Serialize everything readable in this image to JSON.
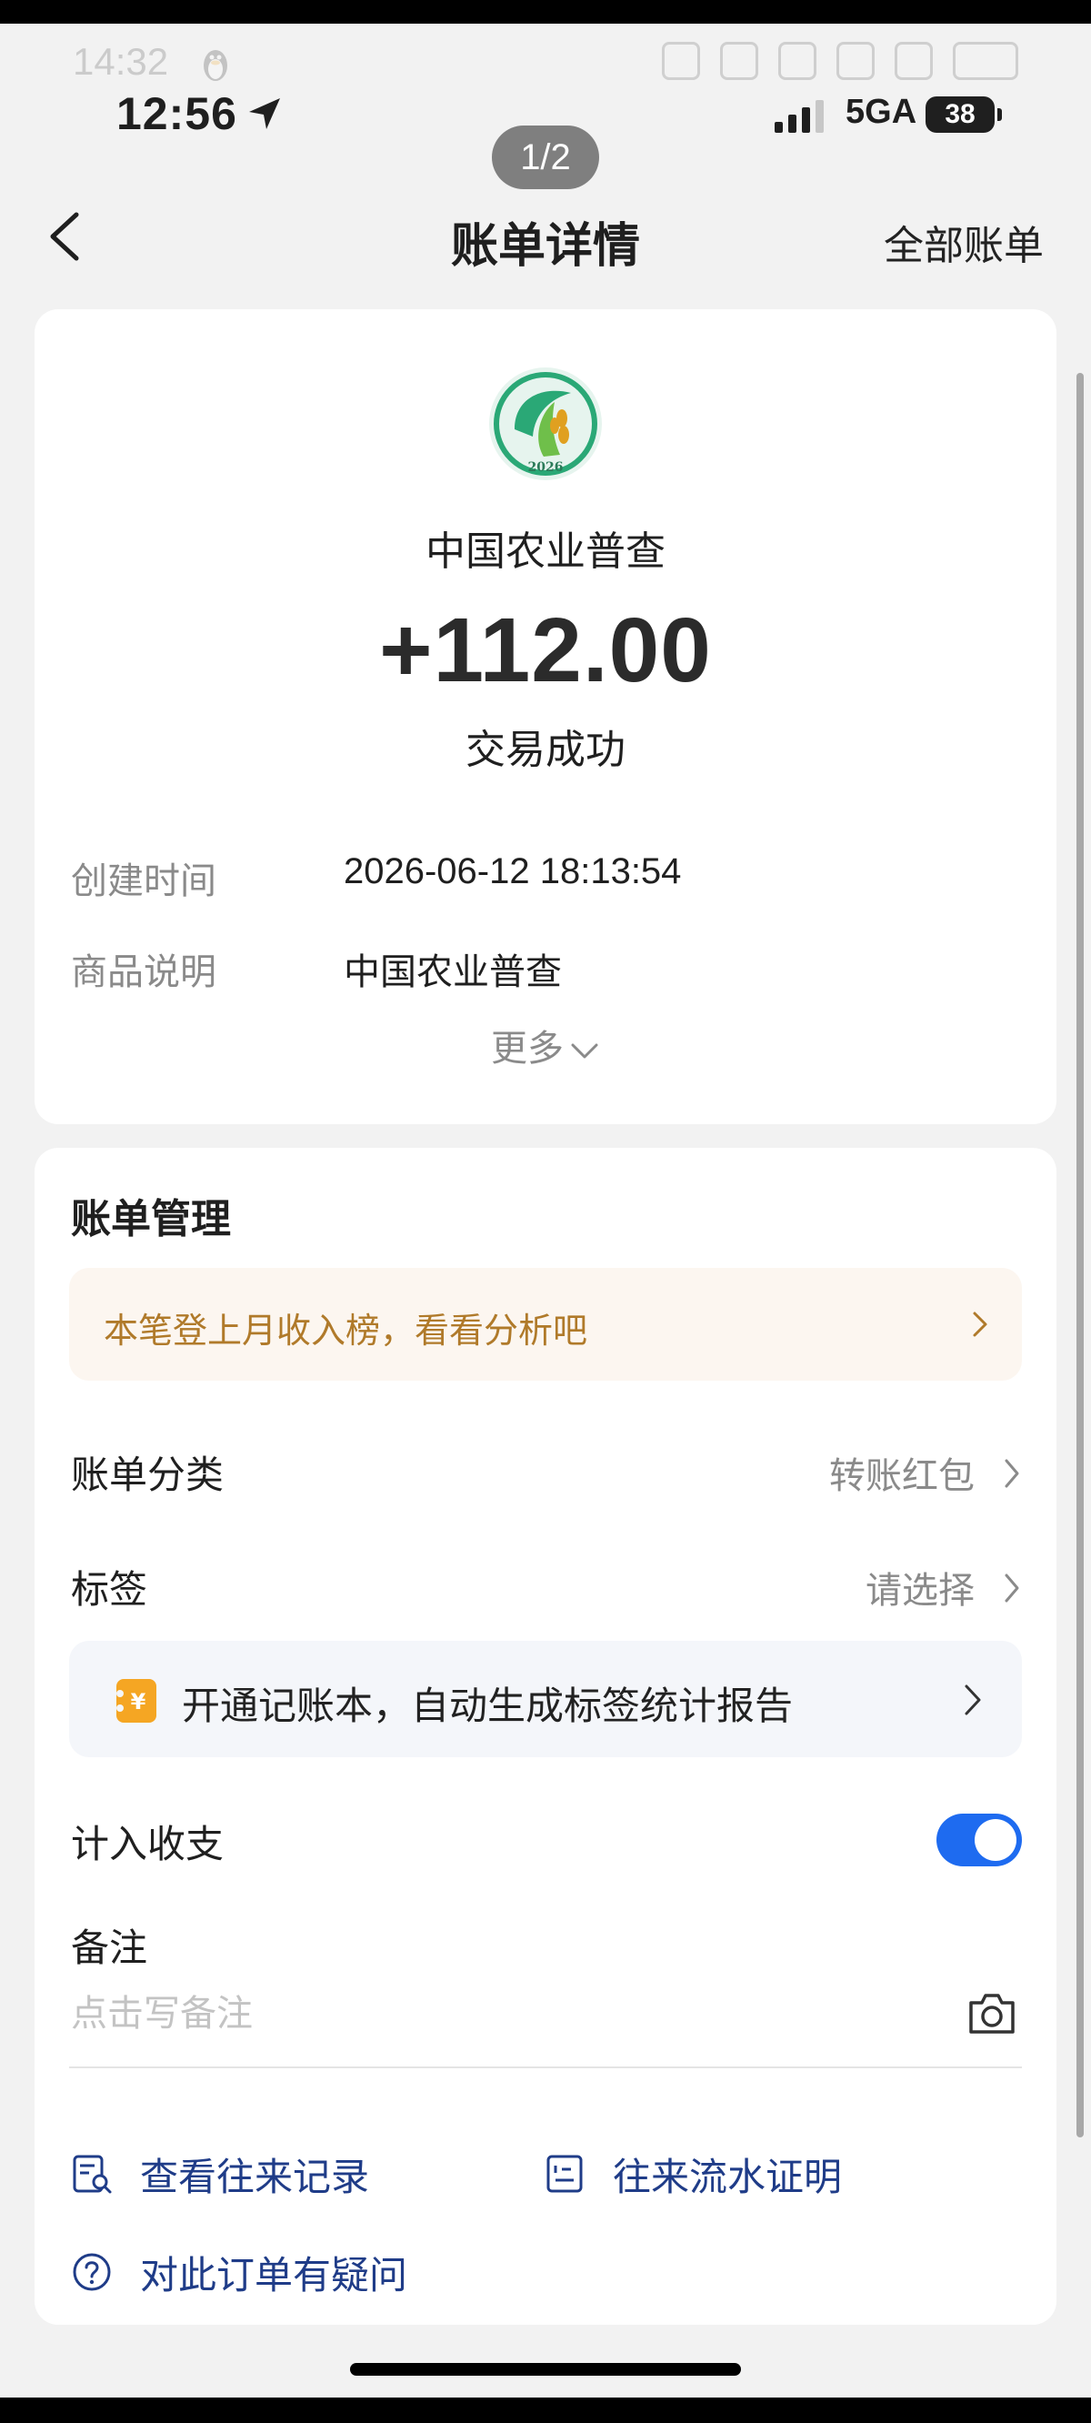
{
  "ghost_status": {
    "time": "14:32"
  },
  "status_bar": {
    "time": "12:56",
    "network": "5GA",
    "battery": "38"
  },
  "page_indicator": "1/2",
  "nav": {
    "title": "账单详情",
    "right_link": "全部账单"
  },
  "transaction": {
    "merchant": "中国农业普查",
    "logo_year": "2026",
    "amount": "+112.00",
    "status": "交易成功",
    "details": [
      {
        "label": "创建时间",
        "value": "2026-06-12 18:13:54"
      },
      {
        "label": "商品说明",
        "value": "中国农业普查"
      }
    ],
    "more": "更多"
  },
  "management": {
    "title": "账单管理",
    "promo": "本笔登上月收入榜，看看分析吧",
    "category": {
      "label": "账单分类",
      "value": "转账红包"
    },
    "tag": {
      "label": "标签",
      "value": "请选择"
    },
    "notebook": {
      "icon_text": "¥",
      "text": "开通记账本，自动生成标签统计报告"
    },
    "include": {
      "label": "计入收支",
      "enabled": true
    },
    "remark": {
      "label": "备注",
      "placeholder": "点击写备注",
      "value": ""
    },
    "links": {
      "history": "查看往来记录",
      "proof": "往来流水证明",
      "question": "对此订单有疑问"
    }
  },
  "colors": {
    "accent": "#1e6bf0",
    "promo_text": "#b07a2a",
    "link_text": "#1f3c88"
  }
}
